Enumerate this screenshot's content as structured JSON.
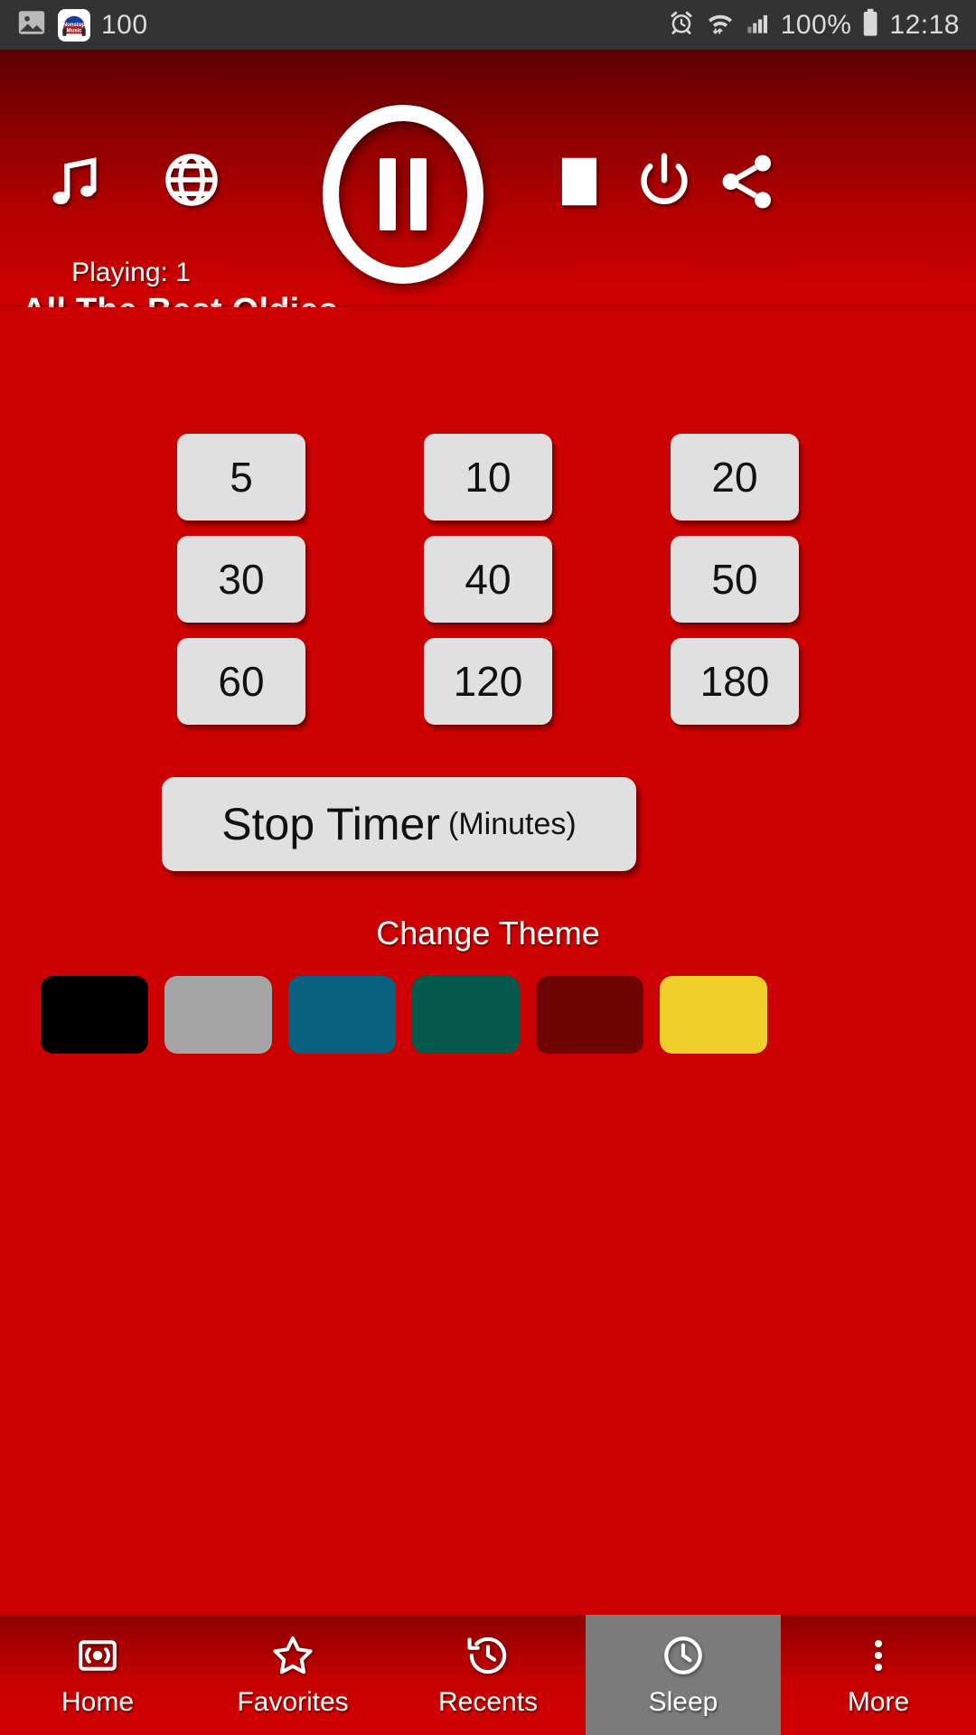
{
  "status_bar": {
    "image_icon": "image-icon",
    "app_icon": "nonstop-music-app-icon",
    "app_icon_text_top": "Nonstop",
    "app_icon_text_bottom": "Music",
    "notification_count": "100",
    "alarm_icon": "alarm-icon",
    "wifi_icon": "wifi-icon",
    "signal_icon": "signal-bars-icon",
    "battery_percent": "100%",
    "battery_icon": "battery-icon",
    "clock": "12:18",
    "background": "#333333"
  },
  "header": {
    "music_icon": "music-note-icon",
    "globe_icon": "globe-icon",
    "pause_icon": "pause-circle-icon",
    "stop_icon": "stop-square-icon",
    "power_icon": "power-icon",
    "share_icon": "share-icon",
    "playing_label": "Playing: 1",
    "station_title": "All The Best Oldies",
    "gradient_top": "#5E0000",
    "gradient_bottom": "#D20000"
  },
  "main": {
    "background": "#CC0000",
    "timer_rows": [
      [
        "5",
        "10",
        "20"
      ],
      [
        "30",
        "40",
        "50"
      ],
      [
        "60",
        "120",
        "180"
      ]
    ],
    "stop_timer": {
      "main_label": "Stop Timer",
      "sub_label": "(Minutes)"
    },
    "change_theme_label": "Change Theme",
    "theme_swatches": [
      {
        "name": "theme-black",
        "color": "#000000"
      },
      {
        "name": "theme-gray",
        "color": "#A5A5A5"
      },
      {
        "name": "theme-blue",
        "color": "#0A617F"
      },
      {
        "name": "theme-green",
        "color": "#04584C"
      },
      {
        "name": "theme-maroon",
        "color": "#6E0404"
      },
      {
        "name": "theme-yellow",
        "color": "#F0CF2B"
      }
    ],
    "button_face": "#E0E0E0"
  },
  "bottom_nav": {
    "items": [
      {
        "label": "Home",
        "icon": "radio-icon",
        "selected": false
      },
      {
        "label": "Favorites",
        "icon": "star-icon",
        "selected": false
      },
      {
        "label": "Recents",
        "icon": "history-clock-icon",
        "selected": false
      },
      {
        "label": "Sleep",
        "icon": "clock-icon",
        "selected": true
      },
      {
        "label": "More",
        "icon": "more-vertical-icon",
        "selected": false
      }
    ],
    "selected_background": "#7B7B7B"
  }
}
